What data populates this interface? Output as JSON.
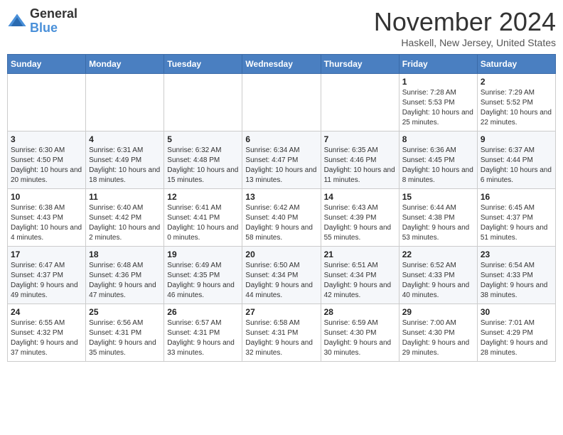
{
  "logo": {
    "text_general": "General",
    "text_blue": "Blue"
  },
  "header": {
    "month": "November 2024",
    "location": "Haskell, New Jersey, United States"
  },
  "days_of_week": [
    "Sunday",
    "Monday",
    "Tuesday",
    "Wednesday",
    "Thursday",
    "Friday",
    "Saturday"
  ],
  "weeks": [
    [
      {
        "day": "",
        "info": ""
      },
      {
        "day": "",
        "info": ""
      },
      {
        "day": "",
        "info": ""
      },
      {
        "day": "",
        "info": ""
      },
      {
        "day": "",
        "info": ""
      },
      {
        "day": "1",
        "info": "Sunrise: 7:28 AM\nSunset: 5:53 PM\nDaylight: 10 hours and 25 minutes."
      },
      {
        "day": "2",
        "info": "Sunrise: 7:29 AM\nSunset: 5:52 PM\nDaylight: 10 hours and 22 minutes."
      }
    ],
    [
      {
        "day": "3",
        "info": "Sunrise: 6:30 AM\nSunset: 4:50 PM\nDaylight: 10 hours and 20 minutes."
      },
      {
        "day": "4",
        "info": "Sunrise: 6:31 AM\nSunset: 4:49 PM\nDaylight: 10 hours and 18 minutes."
      },
      {
        "day": "5",
        "info": "Sunrise: 6:32 AM\nSunset: 4:48 PM\nDaylight: 10 hours and 15 minutes."
      },
      {
        "day": "6",
        "info": "Sunrise: 6:34 AM\nSunset: 4:47 PM\nDaylight: 10 hours and 13 minutes."
      },
      {
        "day": "7",
        "info": "Sunrise: 6:35 AM\nSunset: 4:46 PM\nDaylight: 10 hours and 11 minutes."
      },
      {
        "day": "8",
        "info": "Sunrise: 6:36 AM\nSunset: 4:45 PM\nDaylight: 10 hours and 8 minutes."
      },
      {
        "day": "9",
        "info": "Sunrise: 6:37 AM\nSunset: 4:44 PM\nDaylight: 10 hours and 6 minutes."
      }
    ],
    [
      {
        "day": "10",
        "info": "Sunrise: 6:38 AM\nSunset: 4:43 PM\nDaylight: 10 hours and 4 minutes."
      },
      {
        "day": "11",
        "info": "Sunrise: 6:40 AM\nSunset: 4:42 PM\nDaylight: 10 hours and 2 minutes."
      },
      {
        "day": "12",
        "info": "Sunrise: 6:41 AM\nSunset: 4:41 PM\nDaylight: 10 hours and 0 minutes."
      },
      {
        "day": "13",
        "info": "Sunrise: 6:42 AM\nSunset: 4:40 PM\nDaylight: 9 hours and 58 minutes."
      },
      {
        "day": "14",
        "info": "Sunrise: 6:43 AM\nSunset: 4:39 PM\nDaylight: 9 hours and 55 minutes."
      },
      {
        "day": "15",
        "info": "Sunrise: 6:44 AM\nSunset: 4:38 PM\nDaylight: 9 hours and 53 minutes."
      },
      {
        "day": "16",
        "info": "Sunrise: 6:45 AM\nSunset: 4:37 PM\nDaylight: 9 hours and 51 minutes."
      }
    ],
    [
      {
        "day": "17",
        "info": "Sunrise: 6:47 AM\nSunset: 4:37 PM\nDaylight: 9 hours and 49 minutes."
      },
      {
        "day": "18",
        "info": "Sunrise: 6:48 AM\nSunset: 4:36 PM\nDaylight: 9 hours and 47 minutes."
      },
      {
        "day": "19",
        "info": "Sunrise: 6:49 AM\nSunset: 4:35 PM\nDaylight: 9 hours and 46 minutes."
      },
      {
        "day": "20",
        "info": "Sunrise: 6:50 AM\nSunset: 4:34 PM\nDaylight: 9 hours and 44 minutes."
      },
      {
        "day": "21",
        "info": "Sunrise: 6:51 AM\nSunset: 4:34 PM\nDaylight: 9 hours and 42 minutes."
      },
      {
        "day": "22",
        "info": "Sunrise: 6:52 AM\nSunset: 4:33 PM\nDaylight: 9 hours and 40 minutes."
      },
      {
        "day": "23",
        "info": "Sunrise: 6:54 AM\nSunset: 4:33 PM\nDaylight: 9 hours and 38 minutes."
      }
    ],
    [
      {
        "day": "24",
        "info": "Sunrise: 6:55 AM\nSunset: 4:32 PM\nDaylight: 9 hours and 37 minutes."
      },
      {
        "day": "25",
        "info": "Sunrise: 6:56 AM\nSunset: 4:31 PM\nDaylight: 9 hours and 35 minutes."
      },
      {
        "day": "26",
        "info": "Sunrise: 6:57 AM\nSunset: 4:31 PM\nDaylight: 9 hours and 33 minutes."
      },
      {
        "day": "27",
        "info": "Sunrise: 6:58 AM\nSunset: 4:31 PM\nDaylight: 9 hours and 32 minutes."
      },
      {
        "day": "28",
        "info": "Sunrise: 6:59 AM\nSunset: 4:30 PM\nDaylight: 9 hours and 30 minutes."
      },
      {
        "day": "29",
        "info": "Sunrise: 7:00 AM\nSunset: 4:30 PM\nDaylight: 9 hours and 29 minutes."
      },
      {
        "day": "30",
        "info": "Sunrise: 7:01 AM\nSunset: 4:29 PM\nDaylight: 9 hours and 28 minutes."
      }
    ]
  ]
}
